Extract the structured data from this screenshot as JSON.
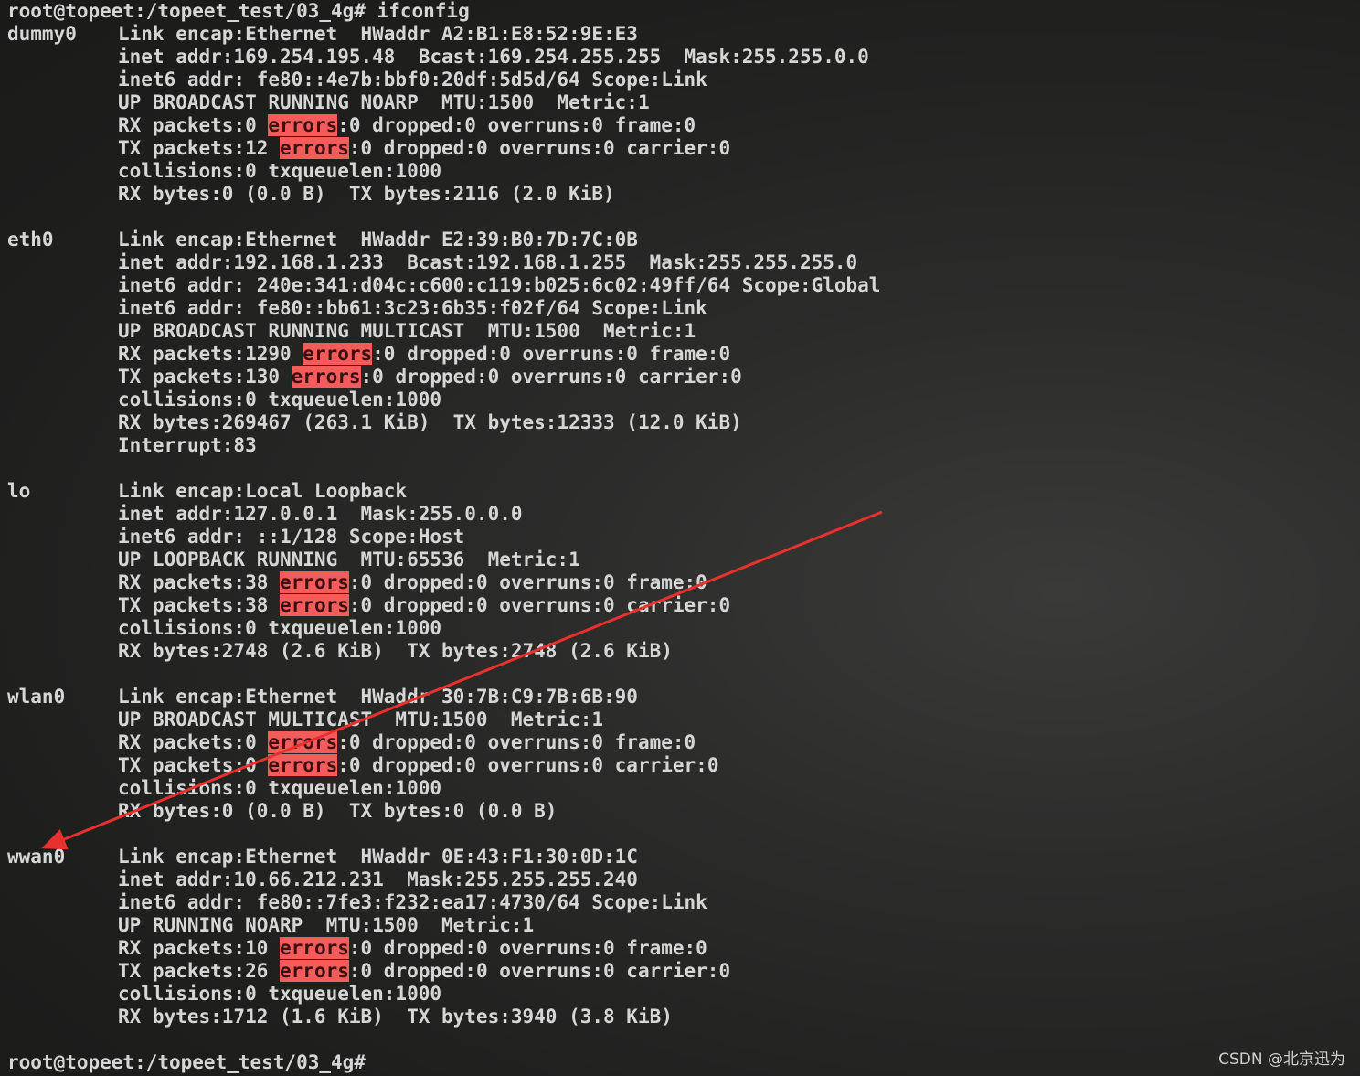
{
  "terminal": {
    "prompt_command": "root@topeet:/topeet_test/03_4g# ifconfig",
    "prompt_end": "root@topeet:/topeet_test/03_4g#",
    "highlight_term": "errors",
    "interfaces": [
      {
        "name": "dummy0",
        "lines": [
          "Link encap:Ethernet  HWaddr A2:B1:E8:52:9E:E3",
          "inet addr:169.254.195.48  Bcast:169.254.255.255  Mask:255.255.0.0",
          "inet6 addr: fe80::4e7b:bbf0:20df:5d5d/64 Scope:Link",
          "UP BROADCAST RUNNING NOARP  MTU:1500  Metric:1",
          "RX packets:0 errors:0 dropped:0 overruns:0 frame:0",
          "TX packets:12 errors:0 dropped:0 overruns:0 carrier:0",
          "collisions:0 txqueuelen:1000",
          "RX bytes:0 (0.0 B)  TX bytes:2116 (2.0 KiB)"
        ]
      },
      {
        "name": "eth0",
        "lines": [
          "Link encap:Ethernet  HWaddr E2:39:B0:7D:7C:0B",
          "inet addr:192.168.1.233  Bcast:192.168.1.255  Mask:255.255.255.0",
          "inet6 addr: 240e:341:d04c:c600:c119:b025:6c02:49ff/64 Scope:Global",
          "inet6 addr: fe80::bb61:3c23:6b35:f02f/64 Scope:Link",
          "UP BROADCAST RUNNING MULTICAST  MTU:1500  Metric:1",
          "RX packets:1290 errors:0 dropped:0 overruns:0 frame:0",
          "TX packets:130 errors:0 dropped:0 overruns:0 carrier:0",
          "collisions:0 txqueuelen:1000",
          "RX bytes:269467 (263.1 KiB)  TX bytes:12333 (12.0 KiB)",
          "Interrupt:83"
        ]
      },
      {
        "name": "lo",
        "lines": [
          "Link encap:Local Loopback",
          "inet addr:127.0.0.1  Mask:255.0.0.0",
          "inet6 addr: ::1/128 Scope:Host",
          "UP LOOPBACK RUNNING  MTU:65536  Metric:1",
          "RX packets:38 errors:0 dropped:0 overruns:0 frame:0",
          "TX packets:38 errors:0 dropped:0 overruns:0 carrier:0",
          "collisions:0 txqueuelen:1000",
          "RX bytes:2748 (2.6 KiB)  TX bytes:2748 (2.6 KiB)"
        ]
      },
      {
        "name": "wlan0",
        "lines": [
          "Link encap:Ethernet  HWaddr 30:7B:C9:7B:6B:90",
          "UP BROADCAST MULTICAST  MTU:1500  Metric:1",
          "RX packets:0 errors:0 dropped:0 overruns:0 frame:0",
          "TX packets:0 errors:0 dropped:0 overruns:0 carrier:0",
          "collisions:0 txqueuelen:1000",
          "RX bytes:0 (0.0 B)  TX bytes:0 (0.0 B)"
        ]
      },
      {
        "name": "wwan0",
        "lines": [
          "Link encap:Ethernet  HWaddr 0E:43:F1:30:0D:1C",
          "inet addr:10.66.212.231  Mask:255.255.255.240",
          "inet6 addr: fe80::7fe3:f232:ea17:4730/64 Scope:Link",
          "UP RUNNING NOARP  MTU:1500  Metric:1",
          "RX packets:10 errors:0 dropped:0 overruns:0 frame:0",
          "TX packets:26 errors:0 dropped:0 overruns:0 carrier:0",
          "collisions:0 txqueuelen:1000",
          "RX bytes:1712 (1.6 KiB)  TX bytes:3940 (3.8 KiB)"
        ]
      }
    ]
  },
  "annotation": {
    "arrow_color": "#e8312f",
    "arrow_points_to": "wwan0"
  },
  "watermark": "CSDN @北京迅为",
  "colors": {
    "highlight": "#f45b5b",
    "text": "#d6d6d6",
    "background": "#1e1e1d"
  }
}
